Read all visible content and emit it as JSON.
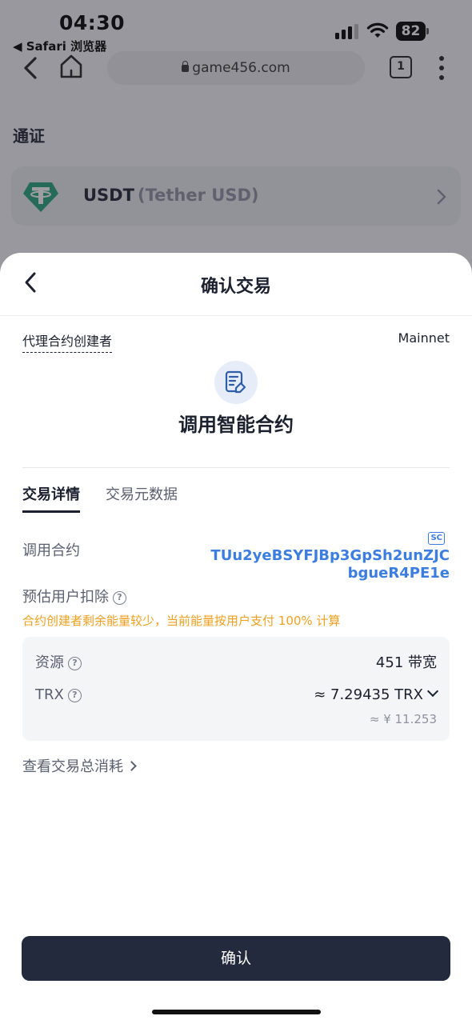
{
  "status_bar": {
    "time": "04:30",
    "back_app": "◀ Safari 浏览器",
    "battery": "82"
  },
  "browser": {
    "url": "game456.com",
    "tab_count": "1"
  },
  "background_page": {
    "section_title": "通证",
    "token": {
      "symbol": "USDT",
      "name": "(Tether USD)"
    }
  },
  "sheet": {
    "title": "确认交易",
    "proxy_label": "代理合约创建者",
    "network": "Mainnet",
    "action_title": "调用智能合约",
    "tabs": [
      {
        "label": "交易详情",
        "active": true
      },
      {
        "label": "交易元数据",
        "active": false
      }
    ],
    "contract": {
      "label": "调用合约",
      "badge": "SC",
      "address_line1": "TUu2yeBSYFJBp3GpSh2unZJC",
      "address_line2": "bgueR4PE1e"
    },
    "deduction": {
      "label": "预估用户扣除",
      "warning": "合约创建者剩余能量较少，当前能量按用户支付 100% 计算"
    },
    "resources": {
      "resource_label": "资源",
      "resource_value": "451 带宽",
      "trx_label": "TRX",
      "trx_value": "≈  7.29435 TRX",
      "trx_fiat": "≈ ¥  11.253"
    },
    "total_link": "查看交易总消耗",
    "confirm_button": "确认"
  },
  "colors": {
    "accent": "#3b7de0",
    "warning": "#f0a020",
    "primary_button": "#232a3d",
    "tether_green": "#26a17b"
  }
}
